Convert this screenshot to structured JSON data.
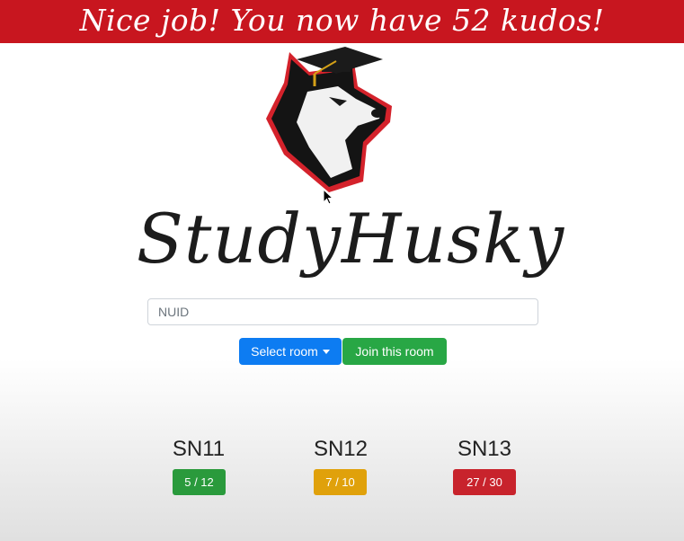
{
  "banner": {
    "text": "Nice job! You now have 52 kudos!",
    "color": "#c8161f"
  },
  "brand": {
    "name": "StudyHusky",
    "logo_icon": "husky-graduation-cap-logo"
  },
  "nuid_input": {
    "placeholder": "NUID",
    "value": ""
  },
  "buttons": {
    "select_room": "Select room",
    "join_room": "Join this room"
  },
  "rooms": [
    {
      "name": "SN11",
      "occupancy": "5 / 12",
      "status_color": "#2a9a3c"
    },
    {
      "name": "SN12",
      "occupancy": "7 / 10",
      "status_color": "#e0a10b"
    },
    {
      "name": "SN13",
      "occupancy": "27 / 30",
      "status_color": "#c8232c"
    }
  ]
}
